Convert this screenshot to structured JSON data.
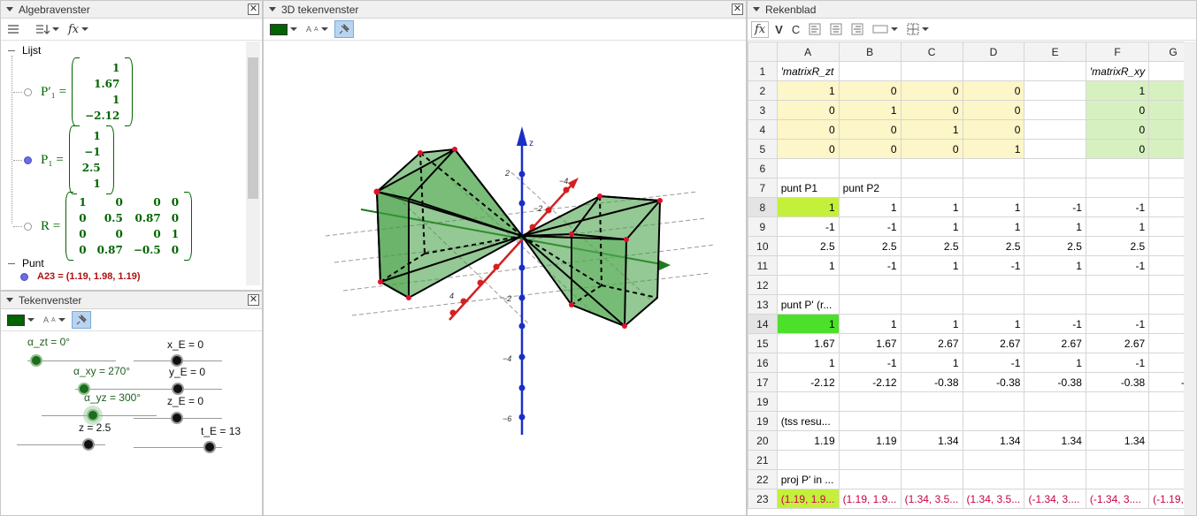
{
  "algebra": {
    "title": "Algebravenster",
    "category_lijst": "Lijst",
    "category_punt": "Punt",
    "p1_prime_name": "P′₁ =",
    "p1_prime": [
      "1",
      "1.67",
      "1",
      "−2.12"
    ],
    "p1_name": "P₁ =",
    "p1": [
      "1",
      "−1",
      "2.5",
      "1"
    ],
    "r_name": "R =",
    "r": [
      [
        "1",
        "0",
        "0",
        "0"
      ],
      [
        "0",
        "0.5",
        "0.87",
        "0"
      ],
      [
        "0",
        "0",
        "0",
        "1"
      ],
      [
        "0",
        "0.87",
        "−0.5",
        "0"
      ]
    ],
    "a23": "A23 = (1.19, 1.98, 1.19)"
  },
  "graphics2d": {
    "title": "Tekenvenster",
    "sliders": [
      {
        "label": "α_zt = 0°"
      },
      {
        "label": "α_xy = 270°"
      },
      {
        "label": "α_yz = 300°"
      },
      {
        "label": "z = 2.5"
      },
      {
        "label": "x_E = 0"
      },
      {
        "label": "y_E = 0"
      },
      {
        "label": "z_E = 0"
      },
      {
        "label": "t_E = 13"
      }
    ]
  },
  "view3d": {
    "title": "3D tekenvenster",
    "axis_z": "z",
    "z_ticks": [
      "2",
      "−2",
      "−4",
      "−6"
    ],
    "y_ticks": [
      "−4",
      "−2",
      "4"
    ]
  },
  "sheet": {
    "title": "Rekenblad",
    "toolbar": {
      "fx": "fx",
      "v": "V",
      "c": "C"
    },
    "columns": [
      "A",
      "B",
      "C",
      "D",
      "E",
      "F",
      "G"
    ],
    "rows": [
      {
        "n": "1",
        "cells": [
          "′matrixR_zt",
          "",
          "",
          "",
          "",
          "′matrixR_xy",
          ""
        ]
      },
      {
        "n": "2",
        "cells": [
          "1",
          "0",
          "0",
          "0",
          "",
          "1",
          ""
        ]
      },
      {
        "n": "3",
        "cells": [
          "0",
          "1",
          "0",
          "0",
          "",
          "0",
          ""
        ]
      },
      {
        "n": "4",
        "cells": [
          "0",
          "0",
          "1",
          "0",
          "",
          "0",
          ""
        ]
      },
      {
        "n": "5",
        "cells": [
          "0",
          "0",
          "0",
          "1",
          "",
          "0",
          ""
        ]
      },
      {
        "n": "6",
        "cells": [
          "",
          "",
          "",
          "",
          "",
          "",
          ""
        ]
      },
      {
        "n": "7",
        "cells": [
          "punt P1",
          "punt P2",
          "",
          "",
          "",
          "",
          ""
        ]
      },
      {
        "n": "8",
        "cells": [
          "1",
          "1",
          "1",
          "1",
          "-1",
          "-1",
          ""
        ]
      },
      {
        "n": "9",
        "cells": [
          "-1",
          "-1",
          "1",
          "1",
          "1",
          "1",
          ""
        ]
      },
      {
        "n": "10",
        "cells": [
          "2.5",
          "2.5",
          "2.5",
          "2.5",
          "2.5",
          "2.5",
          "2"
        ]
      },
      {
        "n": "11",
        "cells": [
          "1",
          "-1",
          "1",
          "-1",
          "1",
          "-1",
          ""
        ]
      },
      {
        "n": "12",
        "cells": [
          "",
          "",
          "",
          "",
          "",
          "",
          ""
        ]
      },
      {
        "n": "13",
        "cells": [
          "punt P' (r...",
          "",
          "",
          "",
          "",
          "",
          ""
        ]
      },
      {
        "n": "14",
        "cells": [
          "1",
          "1",
          "1",
          "1",
          "-1",
          "-1",
          ""
        ]
      },
      {
        "n": "15",
        "cells": [
          "1.67",
          "1.67",
          "2.67",
          "2.67",
          "2.67",
          "2.67",
          "1."
        ]
      },
      {
        "n": "16",
        "cells": [
          "1",
          "-1",
          "1",
          "-1",
          "1",
          "-1",
          ""
        ]
      },
      {
        "n": "17",
        "cells": [
          "-2.12",
          "-2.12",
          "-0.38",
          "-0.38",
          "-0.38",
          "-0.38",
          "-2."
        ]
      },
      {
        "n": "19",
        "cells": [
          "",
          "",
          "",
          "",
          "",
          "",
          ""
        ]
      },
      {
        "n": "19",
        "cells": [
          "(tss resu...",
          "",
          "",
          "",
          "",
          "",
          ""
        ]
      },
      {
        "n": "20",
        "cells": [
          "1.19",
          "1.19",
          "1.34",
          "1.34",
          "1.34",
          "1.34",
          ""
        ]
      },
      {
        "n": "21",
        "cells": [
          "",
          "",
          "",
          "",
          "",
          "",
          ""
        ]
      },
      {
        "n": "22",
        "cells": [
          "proj P' in ...",
          "",
          "",
          "",
          "",
          "",
          ""
        ]
      },
      {
        "n": "23",
        "cells": [
          "(1.19, 1.9...",
          "(1.19, 1.9...",
          "(1.34, 3.5...",
          "(1.34, 3.5...",
          "(-1.34, 3....",
          "(-1.34, 3....",
          "(-1.19, 1"
        ]
      }
    ]
  }
}
